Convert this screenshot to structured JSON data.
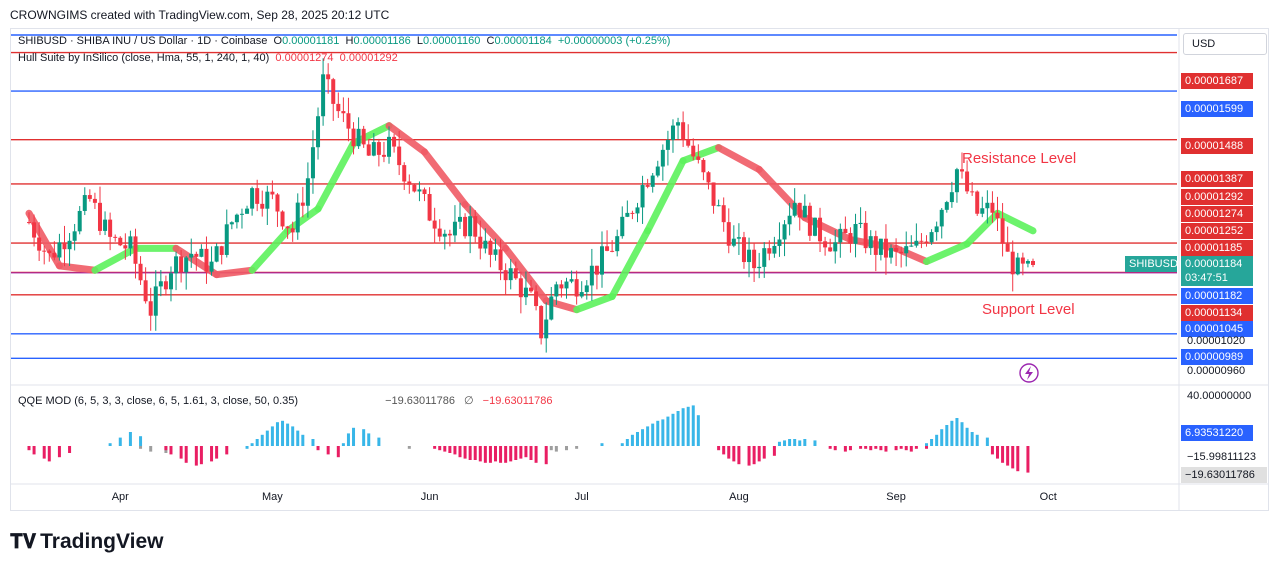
{
  "header": {
    "credit": "CROWNGIMS created with TradingView.com, Sep 28, 2025 20:12 UTC"
  },
  "symbol_line": {
    "symbol": "SHIBUSD · SHIBA INU / US Dollar · 1D · Coinbase",
    "o_label": "O",
    "o": "0.00001181",
    "h_label": "H",
    "h": "0.00001186",
    "l_label": "L",
    "l": "0.00001160",
    "c_label": "C",
    "c": "0.00001184",
    "change": "+0.00000003 (+0.25%)"
  },
  "hull_line": {
    "label": "Hull Suite by InSilico (close, Hma, 55, 1, 240, 1, 40)",
    "v1": "0.00001274",
    "v2": "0.00001292"
  },
  "qqe_line": {
    "label": "QQE MOD (6, 5, 3, 3, close, 6, 5, 1.61, 3, close, 50, 0.35)",
    "v1": "−19.63011786",
    "sym": "∅",
    "v2": "−19.63011786"
  },
  "currency_button": "USD",
  "annotations": {
    "resistance": "Resistance Level",
    "support": "Support Level"
  },
  "colors": {
    "bull": "#089981",
    "bear": "#f23645",
    "hull_up": "#5df25d",
    "hull_down": "#f05b66",
    "red_line": "#e03030",
    "blue_line": "#2962ff",
    "qqe_pink": "#e91e63",
    "qqe_blue": "#38b6e8",
    "qqe_gray": "#9e9e9e"
  },
  "price_axis": {
    "tags": [
      {
        "text": "0.00001687",
        "price": 1.687e-05,
        "color": "#e03030"
      },
      {
        "text": "0.00001599",
        "price": 1.599e-05,
        "color": "#2962ff"
      },
      {
        "text": "0.00001488",
        "price": 1.488e-05,
        "color": "#e03030"
      },
      {
        "text": "0.00001387",
        "price": 1.387e-05,
        "color": "#e03030"
      },
      {
        "text": "0.00001292",
        "price": 1.292e-05,
        "color": "#e03030"
      },
      {
        "text": "0.00001274",
        "price": 1.274e-05,
        "color": "#e03030"
      },
      {
        "text": "0.00001252",
        "price": 1.252e-05,
        "color": "#e03030"
      },
      {
        "text": "0.00001185",
        "price": 1.185e-05,
        "color": "#e03030"
      },
      {
        "text": "0.00001182",
        "price": 1.182e-05,
        "color": "#2962ff"
      },
      {
        "text": "0.00001134",
        "price": 1.134e-05,
        "color": "#e03030"
      },
      {
        "text": "0.00001045",
        "price": 1.045e-05,
        "color": "#2962ff"
      },
      {
        "text": "0.00000989",
        "price": 9.89e-06,
        "color": "#2962ff"
      }
    ],
    "plain_labels": [
      {
        "text": "0.00001020",
        "price": 1.02e-05
      },
      {
        "text": "0.00000960",
        "price": 9.6e-06
      }
    ],
    "current": {
      "symbol": "SHIBUSD",
      "price_text": "0.00001184",
      "countdown": "03:47:51",
      "color": "#26a69a"
    }
  },
  "qqe_axis": {
    "plain_labels": [
      {
        "text": "40.00000000",
        "value": 40
      },
      {
        "text": "−15.99811123",
        "value": -16
      }
    ],
    "tags": [
      {
        "text": "6.93531220",
        "value": 6.94,
        "color": "#2962ff"
      },
      {
        "text": "−19.63011786",
        "value": -19.63,
        "color": "#e0e0e0"
      }
    ]
  },
  "time_axis": {
    "labels": [
      "Apr",
      "May",
      "Jun",
      "Jul",
      "Aug",
      "Sep",
      "Oct"
    ]
  },
  "chart_data": {
    "type": "candlestick",
    "x_range": [
      "2025-03-14",
      "2025-09-28"
    ],
    "y_range": [
      9.6e-06,
      1.72e-05
    ],
    "horizontal_levels": [
      {
        "price": 1.687e-05,
        "color": "red"
      },
      {
        "price": 1.599e-05,
        "color": "blue"
      },
      {
        "price": 1.488e-05,
        "color": "red"
      },
      {
        "price": 1.387e-05,
        "color": "red"
      },
      {
        "price": 1.252e-05,
        "color": "red"
      },
      {
        "price": 1.185e-05,
        "color": "red"
      },
      {
        "price": 1.134e-05,
        "color": "red"
      },
      {
        "price": 1.045e-05,
        "color": "blue"
      },
      {
        "price": 9.89e-06,
        "color": "blue"
      }
    ],
    "close_path": [
      [
        "2025-03-14",
        1.3e-05
      ],
      [
        "2025-03-18",
        1.22e-05
      ],
      [
        "2025-03-22",
        1.28e-05
      ],
      [
        "2025-03-26",
        1.35e-05
      ],
      [
        "2025-03-30",
        1.26e-05
      ],
      [
        "2025-04-03",
        1.24e-05
      ],
      [
        "2025-04-07",
        1.1e-05
      ],
      [
        "2025-04-11",
        1.2e-05
      ],
      [
        "2025-04-15",
        1.23e-05
      ],
      [
        "2025-04-19",
        1.2e-05
      ],
      [
        "2025-04-23",
        1.3e-05
      ],
      [
        "2025-04-27",
        1.37e-05
      ],
      [
        "2025-05-01",
        1.35e-05
      ],
      [
        "2025-05-05",
        1.28e-05
      ],
      [
        "2025-05-08",
        1.4e-05
      ],
      [
        "2025-05-11",
        1.62e-05
      ],
      [
        "2025-05-14",
        1.55e-05
      ],
      [
        "2025-05-17",
        1.5e-05
      ],
      [
        "2025-05-20",
        1.45e-05
      ],
      [
        "2025-05-24",
        1.47e-05
      ],
      [
        "2025-05-28",
        1.4e-05
      ],
      [
        "2025-06-01",
        1.32e-05
      ],
      [
        "2025-06-05",
        1.27e-05
      ],
      [
        "2025-06-09",
        1.3e-05
      ],
      [
        "2025-06-13",
        1.22e-05
      ],
      [
        "2025-06-17",
        1.18e-05
      ],
      [
        "2025-06-21",
        1.12e-05
      ],
      [
        "2025-06-23",
        1.05e-05
      ],
      [
        "2025-06-26",
        1.16e-05
      ],
      [
        "2025-06-30",
        1.16e-05
      ],
      [
        "2025-07-04",
        1.2e-05
      ],
      [
        "2025-07-08",
        1.26e-05
      ],
      [
        "2025-07-12",
        1.36e-05
      ],
      [
        "2025-07-16",
        1.45e-05
      ],
      [
        "2025-07-20",
        1.53e-05
      ],
      [
        "2025-07-23",
        1.45e-05
      ],
      [
        "2025-07-27",
        1.35e-05
      ],
      [
        "2025-07-31",
        1.25e-05
      ],
      [
        "2025-08-04",
        1.2e-05
      ],
      [
        "2025-08-08",
        1.27e-05
      ],
      [
        "2025-08-12",
        1.35e-05
      ],
      [
        "2025-08-16",
        1.28e-05
      ],
      [
        "2025-08-20",
        1.25e-05
      ],
      [
        "2025-08-24",
        1.28e-05
      ],
      [
        "2025-08-28",
        1.24e-05
      ],
      [
        "2025-09-01",
        1.22e-05
      ],
      [
        "2025-09-05",
        1.24e-05
      ],
      [
        "2025-09-09",
        1.31e-05
      ],
      [
        "2025-09-13",
        1.42e-05
      ],
      [
        "2025-09-17",
        1.32e-05
      ],
      [
        "2025-09-20",
        1.33e-05
      ],
      [
        "2025-09-23",
        1.22e-05
      ],
      [
        "2025-09-25",
        1.19e-05
      ],
      [
        "2025-09-28",
        1.184e-05
      ]
    ],
    "hull_path": [
      [
        "2025-03-14",
        1.32e-05,
        "down"
      ],
      [
        "2025-03-20",
        1.2e-05,
        "down"
      ],
      [
        "2025-03-27",
        1.19e-05,
        "up"
      ],
      [
        "2025-04-04",
        1.24e-05,
        "up"
      ],
      [
        "2025-04-12",
        1.24e-05,
        "down"
      ],
      [
        "2025-04-20",
        1.18e-05,
        "down"
      ],
      [
        "2025-04-27",
        1.19e-05,
        "up"
      ],
      [
        "2025-05-04",
        1.28e-05,
        "up"
      ],
      [
        "2025-05-10",
        1.33e-05,
        "up"
      ],
      [
        "2025-05-17",
        1.48e-05,
        "up"
      ],
      [
        "2025-05-24",
        1.52e-05,
        "down"
      ],
      [
        "2025-05-31",
        1.46e-05,
        "down"
      ],
      [
        "2025-06-08",
        1.34e-05,
        "down"
      ],
      [
        "2025-06-16",
        1.24e-05,
        "down"
      ],
      [
        "2025-06-24",
        1.12e-05,
        "down"
      ],
      [
        "2025-06-30",
        1.1e-05,
        "up"
      ],
      [
        "2025-07-07",
        1.13e-05,
        "up"
      ],
      [
        "2025-07-14",
        1.28e-05,
        "up"
      ],
      [
        "2025-07-21",
        1.44e-05,
        "up"
      ],
      [
        "2025-07-28",
        1.47e-05,
        "down"
      ],
      [
        "2025-08-05",
        1.42e-05,
        "down"
      ],
      [
        "2025-08-14",
        1.31e-05,
        "down"
      ],
      [
        "2025-08-23",
        1.26e-05,
        "down"
      ],
      [
        "2025-09-01",
        1.24e-05,
        "down"
      ],
      [
        "2025-09-07",
        1.21e-05,
        "up"
      ],
      [
        "2025-09-15",
        1.25e-05,
        "up"
      ],
      [
        "2025-09-21",
        1.32e-05,
        "up"
      ],
      [
        "2025-09-28",
        1.28e-05,
        "down"
      ]
    ],
    "qqe_histogram": [
      {
        "from": "2025-03-14",
        "to": "2025-03-22",
        "values": [
          -3,
          -6,
          -9,
          -11,
          -8,
          -5
        ],
        "color": "pink"
      },
      {
        "from": "2025-03-30",
        "to": "2025-04-05",
        "values": [
          2,
          6,
          10,
          7
        ],
        "color": "blue"
      },
      {
        "from": "2025-04-05",
        "to": "2025-04-10",
        "values": [
          -2,
          -4,
          -5
        ],
        "color": "gray"
      },
      {
        "from": "2025-04-10",
        "to": "2025-04-22",
        "values": [
          -3,
          -6,
          -9,
          -12,
          -14,
          -13,
          -11,
          -9,
          -6
        ],
        "color": "pink"
      },
      {
        "from": "2025-04-26",
        "to": "2025-05-09",
        "values": [
          -2,
          2,
          5,
          8,
          11,
          14,
          17,
          18,
          16,
          14,
          11,
          8,
          5
        ],
        "color": "blue"
      },
      {
        "from": "2025-05-10",
        "to": "2025-05-14",
        "values": [
          -3,
          -6,
          -8
        ],
        "color": "pink"
      },
      {
        "from": "2025-05-15",
        "to": "2025-05-22",
        "values": [
          2,
          9,
          13,
          12,
          9,
          6
        ],
        "color": "blue"
      },
      {
        "from": "2025-05-28",
        "to": "2025-05-29",
        "values": [
          -2
        ],
        "color": "gray"
      },
      {
        "from": "2025-06-02",
        "to": "2025-06-24",
        "values": [
          -2,
          -3,
          -4,
          -5,
          -6,
          -8,
          -9,
          -10,
          -10,
          -11,
          -12,
          -12,
          -11,
          -12,
          -12,
          -11,
          -10,
          -9,
          -8,
          -10,
          -12,
          -13
        ],
        "color": "pink"
      },
      {
        "from": "2025-06-25",
        "to": "2025-06-30",
        "values": [
          -3,
          -4,
          -3,
          -2
        ],
        "color": "gray"
      },
      {
        "from": "2025-07-05",
        "to": "2025-07-06",
        "values": [
          2
        ],
        "color": "blue"
      },
      {
        "from": "2025-07-09",
        "to": "2025-07-24",
        "values": [
          2,
          5,
          8,
          10,
          12,
          14,
          16,
          18,
          19,
          21,
          23,
          25,
          27,
          28,
          29,
          22
        ],
        "color": "blue"
      },
      {
        "from": "2025-07-28",
        "to": "2025-08-08",
        "values": [
          -3,
          -6,
          -9,
          -11,
          -13,
          -14,
          -13,
          -11,
          -9,
          -7
        ],
        "color": "pink"
      },
      {
        "from": "2025-08-09",
        "to": "2025-08-16",
        "values": [
          3,
          4,
          5,
          5,
          4,
          5,
          4
        ],
        "color": "blue"
      },
      {
        "from": "2025-08-19",
        "to": "2025-08-25",
        "values": [
          -2,
          -3,
          -4,
          -3,
          -2
        ],
        "color": "pink"
      },
      {
        "from": "2025-08-26",
        "to": "2025-09-07",
        "values": [
          -2,
          -3,
          -2,
          -3,
          -4,
          -3,
          -2,
          -3,
          -4,
          -2,
          -2
        ],
        "color": "pink"
      },
      {
        "from": "2025-09-07",
        "to": "2025-09-19",
        "values": [
          2,
          5,
          8,
          12,
          15,
          18,
          20,
          17,
          13,
          10,
          8,
          6
        ],
        "color": "blue"
      },
      {
        "from": "2025-09-20",
        "to": "2025-09-27",
        "values": [
          -6,
          -9,
          -12,
          -14,
          -16,
          -18,
          -19
        ],
        "color": "pink"
      }
    ],
    "qqe_range": [
      -30,
      42
    ]
  }
}
